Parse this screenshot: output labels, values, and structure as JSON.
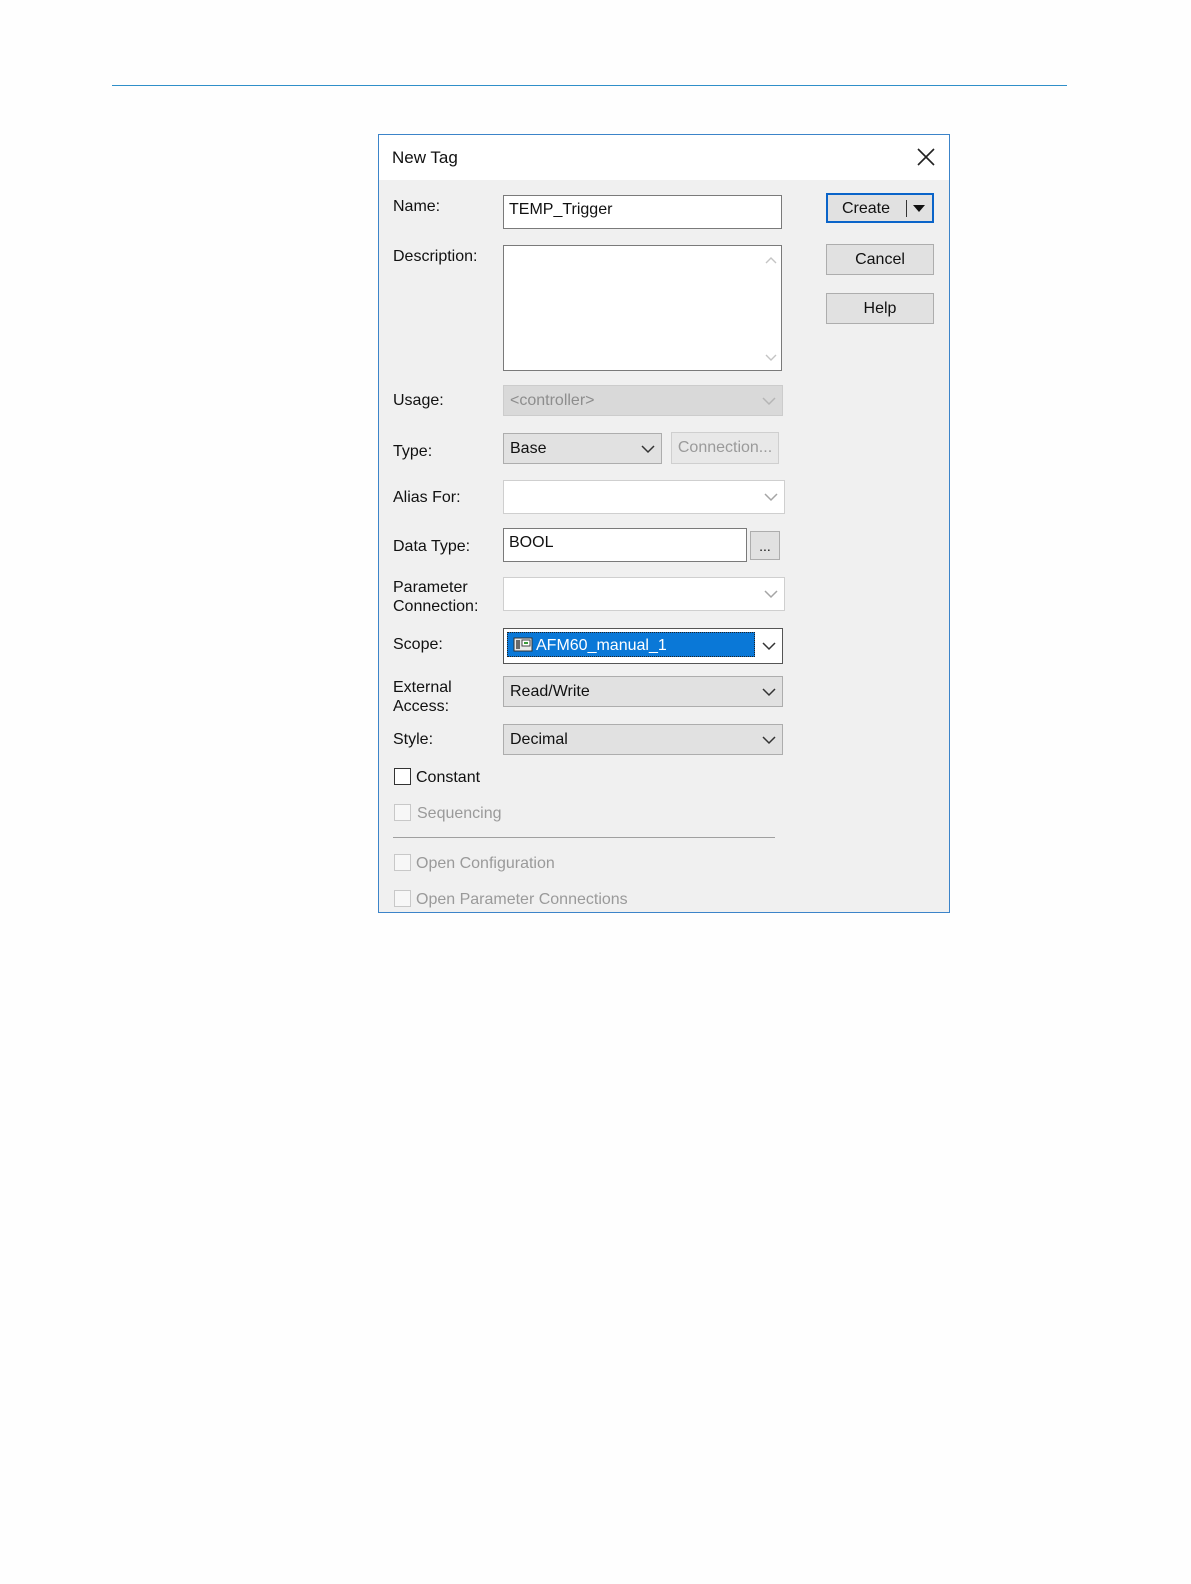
{
  "dialog": {
    "title": "New Tag",
    "close_icon": "close-icon"
  },
  "form": {
    "name_label": "Name:",
    "name_value": "TEMP_Trigger",
    "description_label": "Description:",
    "description_value": "",
    "usage_label": "Usage:",
    "usage_value": "<controller>",
    "type_label": "Type:",
    "type_value": "Base",
    "connection_button": "Connection...",
    "alias_label": "Alias For:",
    "alias_value": "",
    "datatype_label": "Data Type:",
    "datatype_value": "BOOL",
    "browse_button": "...",
    "param_label_line1": "Parameter",
    "param_label_line2": "Connection:",
    "param_value": "",
    "scope_label": "Scope:",
    "scope_value": "AFM60_manual_1",
    "external_label_line1": "External",
    "external_label_line2": "Access:",
    "external_value": "Read/Write",
    "style_label": "Style:",
    "style_value": "Decimal"
  },
  "checkboxes": {
    "constant": "Constant",
    "sequencing": "Sequencing",
    "open_configuration": "Open Configuration",
    "open_parameter_connections": "Open Parameter Connections"
  },
  "buttons": {
    "create": "Create",
    "cancel": "Cancel",
    "help": "Help"
  },
  "colors": {
    "accent": "#0a78d7",
    "dialog_border": "#3c84c9",
    "page_rule": "#2f8fc9"
  }
}
